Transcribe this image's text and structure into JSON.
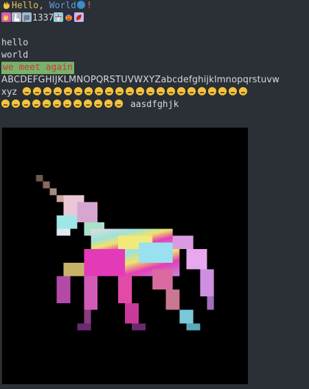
{
  "greeting": {
    "hello": "Hello,",
    "world": "World",
    "excl": "!"
  },
  "leet": "1337",
  "lines": {
    "hello": "hello",
    "world": "world",
    "meet": "we meet again"
  },
  "alphabet": "ABCDEFGHIJKLMNOPQRSTUVWXYZabcdefghijklmnopqrstuvw",
  "alphabet_tail": "xyz",
  "trailing_text": "aasdfghjk",
  "icons": {
    "wave": "waving-hand-icon",
    "globe": "globe-icon",
    "mushroom": "mushroom-icon",
    "pumpkin": "jack-o-lantern-icon",
    "bird": "red-bird-icon",
    "unicorn": "pixel-unicorn-image"
  },
  "colors": {
    "background": "#2b2f36",
    "text": "#d8dbe0",
    "yellow": "#e2c25a",
    "blue": "#5c9be5",
    "highlight_bg": "#79b26a",
    "highlight_fg": "#c83c3c"
  }
}
